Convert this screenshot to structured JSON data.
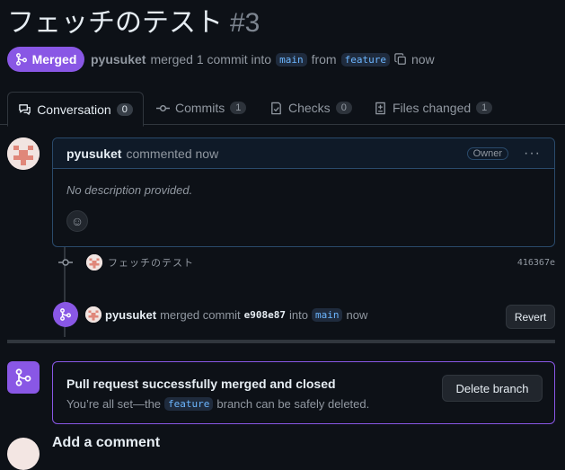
{
  "pr": {
    "title": "フェッチのテスト",
    "number": "#3",
    "state": "Merged",
    "author": "pyusuket",
    "merge_text": "merged 1 commit into",
    "base_branch": "main",
    "from_text": "from",
    "head_branch": "feature",
    "time": "now"
  },
  "tabs": [
    {
      "label": "Conversation",
      "count": "0",
      "icon": "comment-icon"
    },
    {
      "label": "Commits",
      "count": "1",
      "icon": "commit-icon"
    },
    {
      "label": "Checks",
      "count": "0",
      "icon": "checklist-icon"
    },
    {
      "label": "Files changed",
      "count": "1",
      "icon": "file-diff-icon"
    }
  ],
  "comment": {
    "author": "pyusuket",
    "action": "commented now",
    "role": "Owner",
    "body": "No description provided."
  },
  "commit": {
    "message": "フェッチのテスト",
    "sha": "416367e"
  },
  "merge_event": {
    "author": "pyusuket",
    "action": "merged commit",
    "sha": "e908e87",
    "into": "into",
    "branch": "main",
    "time": "now",
    "revert_label": "Revert"
  },
  "merged_box": {
    "title": "Pull request successfully merged and closed",
    "sub_prefix": "You’re all set—the",
    "branch": "feature",
    "sub_suffix": "branch can be safely deleted.",
    "delete_label": "Delete branch"
  },
  "footer": {
    "heading": "Add a comment"
  },
  "colors": {
    "accent": "#8957e5",
    "background": "#0d1117",
    "branch_text": "#6cb6ff"
  }
}
